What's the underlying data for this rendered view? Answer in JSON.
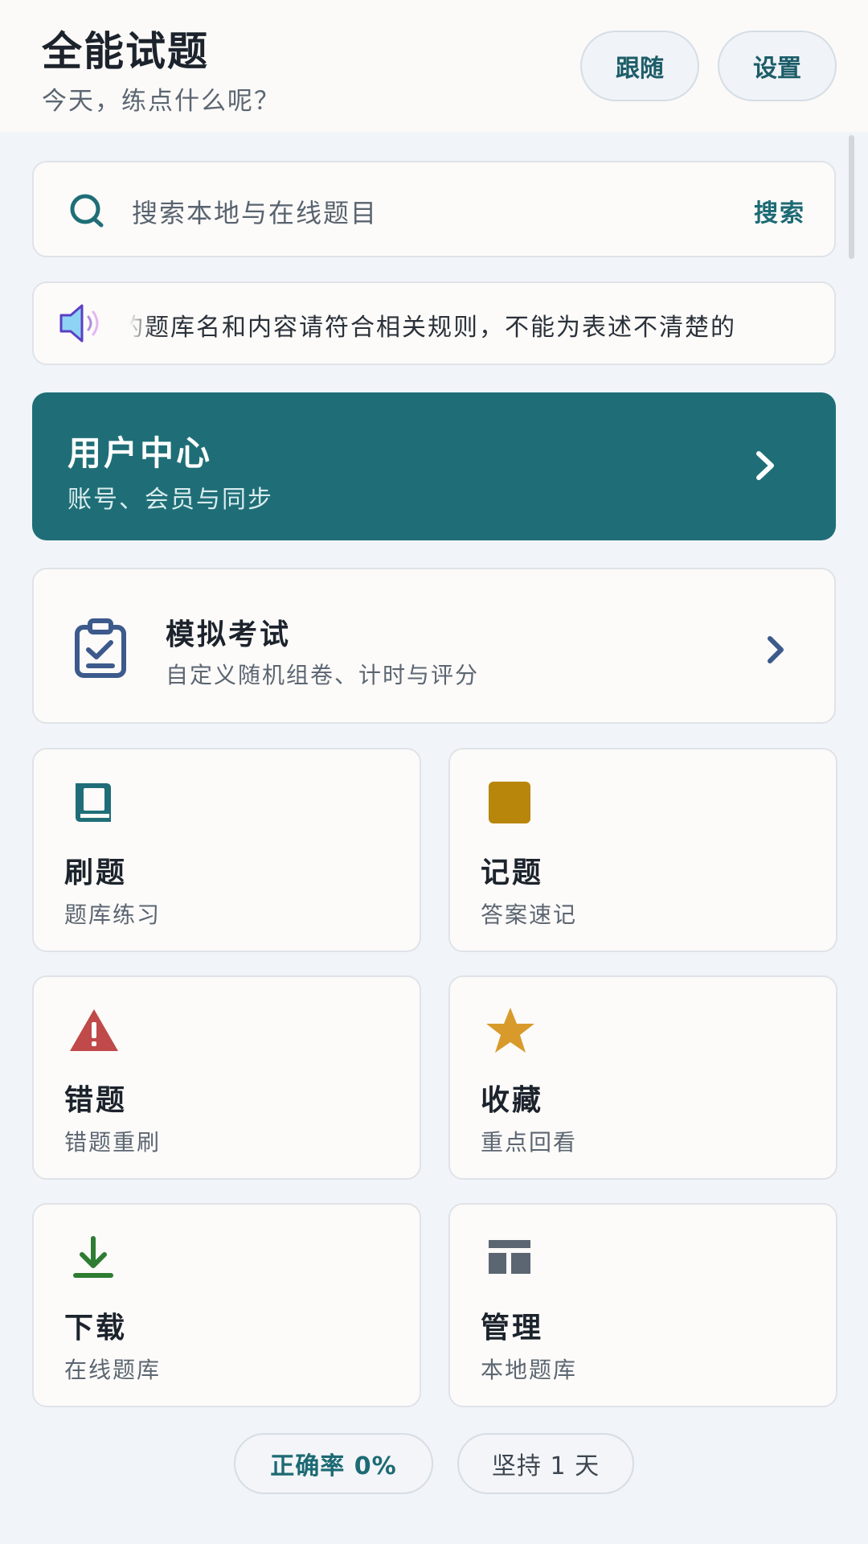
{
  "header": {
    "title": "全能试题",
    "subtitle": "今天，练点什么呢？",
    "follow_label": "跟随",
    "settings_label": "设置"
  },
  "search": {
    "placeholder": "搜索本地与在线题目",
    "action_label": "搜索",
    "icon": "search-icon"
  },
  "notice": {
    "icon": "speaker-icon",
    "text": "的题库名和内容请符合相关规则，不能为表述不清楚的"
  },
  "user_center": {
    "title": "用户中心",
    "subtitle": "账号、会员与同步",
    "icon": "chevron-right-icon"
  },
  "exam": {
    "title": "模拟考试",
    "subtitle": "自定义随机组卷、计时与评分",
    "icon": "clipboard-check-icon"
  },
  "tiles": [
    {
      "title": "刷题",
      "subtitle": "题库练习",
      "icon": "book-icon",
      "color": "#1f6e77"
    },
    {
      "title": "记题",
      "subtitle": "答案速记",
      "icon": "square-icon",
      "color": "#b8860b"
    },
    {
      "title": "错题",
      "subtitle": "错题重刷",
      "icon": "warning-icon",
      "color": "#c0494a"
    },
    {
      "title": "收藏",
      "subtitle": "重点回看",
      "icon": "star-icon",
      "color": "#d89b2b"
    },
    {
      "title": "下载",
      "subtitle": "在线题库",
      "icon": "download-icon",
      "color": "#2e7d32"
    },
    {
      "title": "管理",
      "subtitle": "本地题库",
      "icon": "layout-icon",
      "color": "#5c6672"
    }
  ],
  "stats": {
    "accuracy": "正确率 0%",
    "streak": "坚持 1 天"
  },
  "colors": {
    "accent": "#1f6e77",
    "background": "#f1f4f9",
    "card": "#fcfbf9"
  }
}
